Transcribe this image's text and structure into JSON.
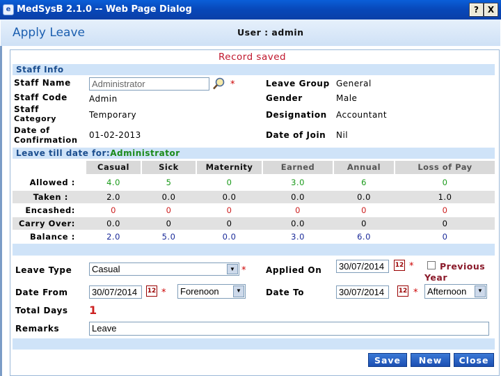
{
  "window": {
    "title": "MedSysB 2.1.0 -- Web Page Dialog",
    "help_btn": "?",
    "close_btn": "X"
  },
  "header": {
    "title": "Apply Leave",
    "user": "User : admin"
  },
  "message": "Record saved",
  "staff_info": {
    "section_title": "Staff Info",
    "staff_name_label": "Staff Name",
    "staff_name_value": "Administrator",
    "staff_code_label": "Staff Code",
    "staff_code_value": "Admin",
    "staff_category_label_1": "Staff",
    "staff_category_label_2": "Category",
    "staff_category_value": "Temporary",
    "confirmation_label_1": "Date of",
    "confirmation_label_2": "Confirmation",
    "confirmation_value": "01-02-2013",
    "leave_group_label": "Leave Group",
    "leave_group_value": "General",
    "gender_label": "Gender",
    "gender_value": "Male",
    "designation_label": "Designation",
    "designation_value": "Accountant",
    "join_label": "Date of Join",
    "join_value": "Nil"
  },
  "leave_till": {
    "label": "Leave till date for:",
    "name": "Administrator"
  },
  "leave_table": {
    "columns": [
      "Casual",
      "Sick",
      "Maternity",
      "Earned",
      "Annual",
      "Loss of Pay"
    ],
    "rows": [
      {
        "label": "Allowed :",
        "values": [
          "4.0",
          "5",
          "0",
          "3.0",
          "6",
          "0"
        ]
      },
      {
        "label": "Taken :",
        "values": [
          "2.0",
          "0.0",
          "0.0",
          "0.0",
          "0.0",
          "1.0"
        ]
      },
      {
        "label": "Encashed:",
        "values": [
          "0",
          "0",
          "0",
          "0",
          "0",
          "0"
        ]
      },
      {
        "label": "Carry Over:",
        "values": [
          "0.0",
          "0",
          "0",
          "0.0",
          "0",
          "0"
        ]
      },
      {
        "label": "Balance :",
        "values": [
          "2.0",
          "5.0",
          "0.0",
          "3.0",
          "6.0",
          "0"
        ]
      }
    ]
  },
  "form": {
    "leave_type_label": "Leave Type",
    "leave_type_value": "Casual",
    "applied_on_label": "Applied On",
    "applied_on_value": "30/07/2014",
    "previous_year_label_1": "Previous",
    "previous_year_label_2": "Year",
    "date_from_label": "Date From",
    "date_from_value": "30/07/2014",
    "from_session_value": "Forenoon",
    "date_to_label": "Date To",
    "date_to_value": "30/07/2014",
    "to_session_value": "Afternoon",
    "total_days_label": "Total Days",
    "total_days_value": "1",
    "remarks_label": "Remarks",
    "remarks_value": "Leave",
    "required_mark": "*"
  },
  "buttons": {
    "save": "Save",
    "new": "New",
    "close": "Close"
  },
  "icons": {
    "search": "magnifier-icon",
    "calendar": "calendar-icon",
    "dropdown": "dropdown-arrow-icon"
  },
  "colors": {
    "titlebar": "#0847b8",
    "section": "#cfe3f8",
    "message": "#c0162c",
    "allowed": "#1a9a1a",
    "encashed": "#cc1f1f",
    "balance": "#1a2a99"
  }
}
